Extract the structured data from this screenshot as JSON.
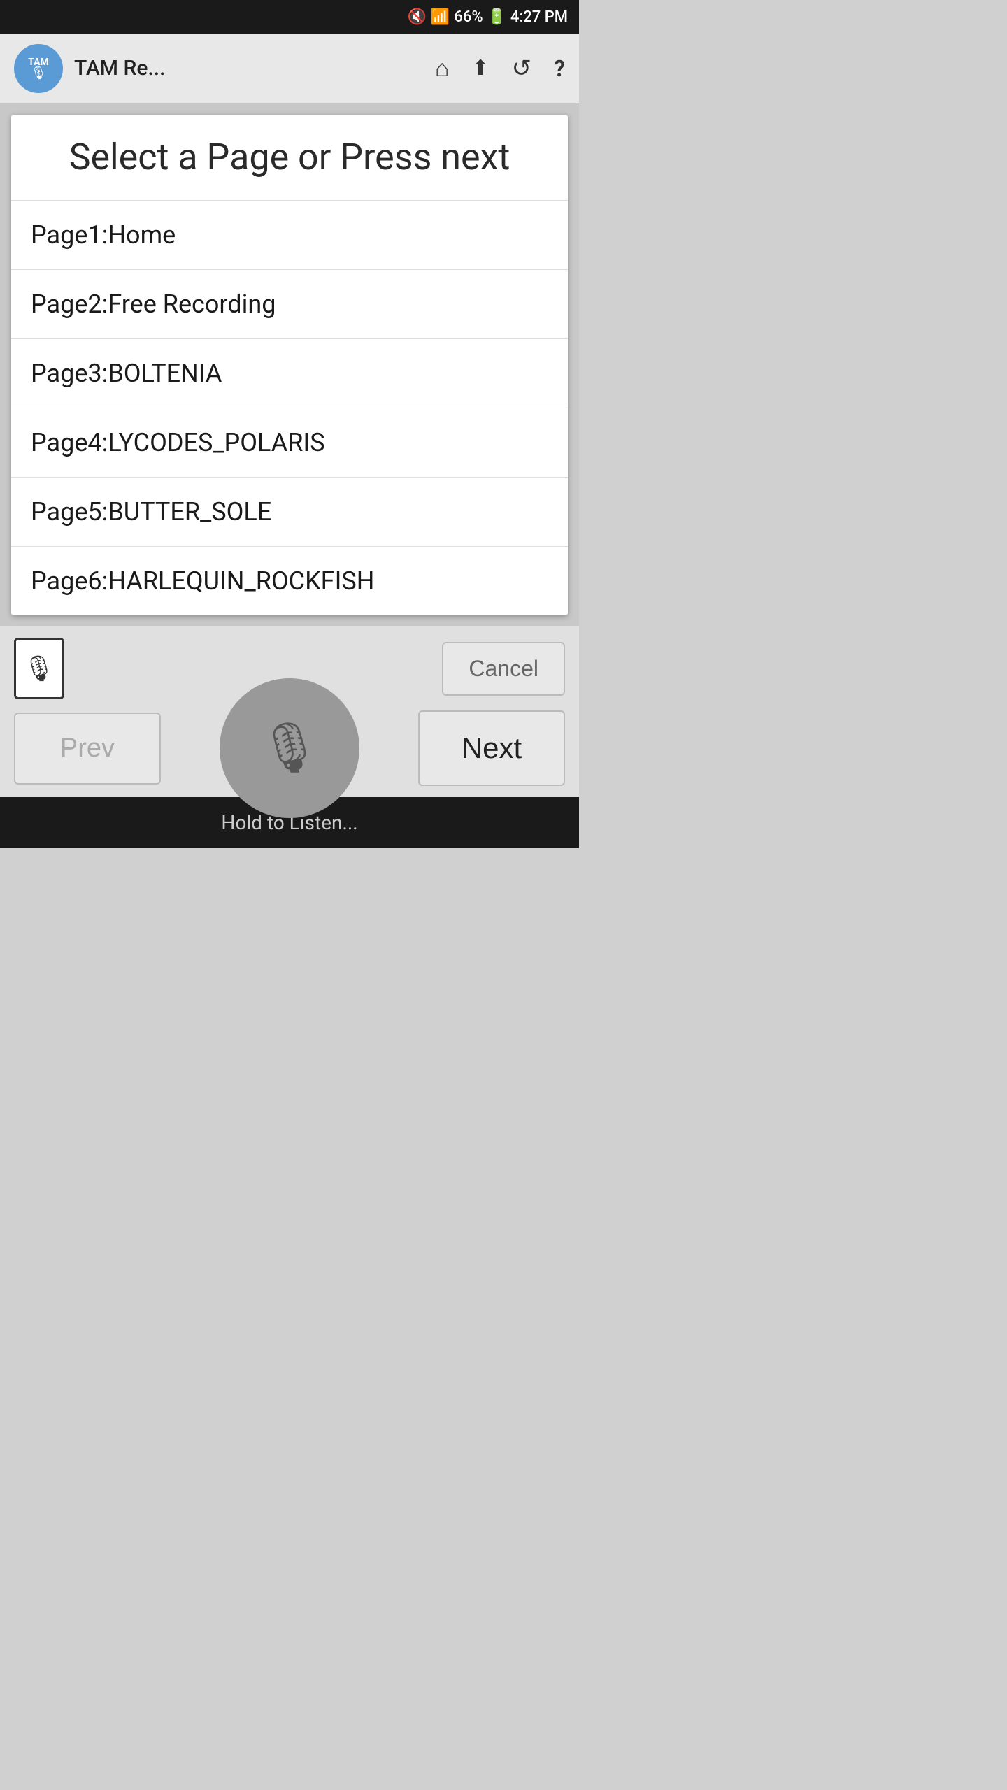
{
  "status_bar": {
    "battery": "66%",
    "time": "4:27 PM",
    "signal_icon": "📶",
    "battery_icon": "🔋",
    "mute_icon": "🔇"
  },
  "app_bar": {
    "logo_text": "TAM",
    "title": "TAM Re...",
    "home_icon": "⌂",
    "upload_icon": "↑",
    "refresh_icon": "↺",
    "help_icon": "?"
  },
  "dialog": {
    "title": "Select a Page or Press next",
    "pages": [
      {
        "label": "Page1:Home"
      },
      {
        "label": "Page2:Free Recording"
      },
      {
        "label": "Page3:BOLTENIA"
      },
      {
        "label": "Page4:LYCODES_POLARIS"
      },
      {
        "label": "Page5:BUTTER_SOLE"
      },
      {
        "label": "Page6:HARLEQUIN_ROCKFISH"
      }
    ]
  },
  "controls": {
    "cancel_label": "Cancel",
    "prev_label": "Prev",
    "next_label": "Next",
    "hold_to_listen": "Hold to Listen..."
  }
}
